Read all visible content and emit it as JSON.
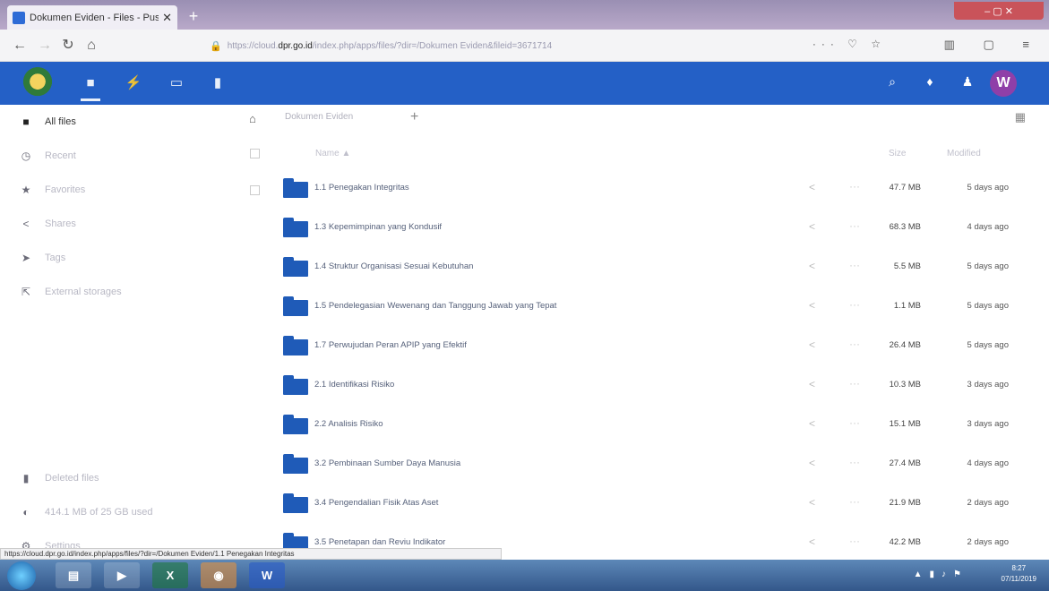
{
  "browser": {
    "tab_title": "Dokumen Eviden - Files - Pus...",
    "tab_close": "✕",
    "new_tab": "+",
    "url_prefix": "https://cloud.",
    "url_host": "dpr.go.id",
    "url_rest": "/index.php/apps/files/?dir=/Dokumen Eviden&fileid=3671714",
    "url_actions": "··· ♡ ☆",
    "right_icons": "▥ ▢ ≡",
    "window_controls": "‒ ▢ ✕"
  },
  "header": {
    "avatar_letter": "W",
    "apps": [
      {
        "name": "files-app",
        "glyph": "■"
      },
      {
        "name": "activity-app",
        "glyph": "⚡"
      },
      {
        "name": "gallery-app",
        "glyph": "▭"
      },
      {
        "name": "notes-app",
        "glyph": "▮"
      }
    ]
  },
  "sidebar": {
    "items": [
      {
        "label": "All files",
        "icon": "folder-icon"
      },
      {
        "label": "Recent",
        "icon": "clock-icon"
      },
      {
        "label": "Favorites",
        "icon": "star-icon"
      },
      {
        "label": "Shares",
        "icon": "share-icon"
      },
      {
        "label": "Tags",
        "icon": "tag-icon"
      },
      {
        "label": "External storages",
        "icon": "external-icon"
      }
    ],
    "deleted": "Deleted files",
    "quota": "414.1 MB of 25 GB used",
    "settings": "Settings"
  },
  "breadcrumb": {
    "current": "Dokumen Eviden"
  },
  "table": {
    "col_name": "Name ▲",
    "col_size": "Size",
    "col_modified": "Modified",
    "rows": [
      {
        "name": "1.1 Penegakan Integritas",
        "size": "47.7 MB",
        "modified": "5 days ago"
      },
      {
        "name": "1.3 Kepemimpinan yang Kondusif",
        "size": "68.3 MB",
        "modified": "4 days ago"
      },
      {
        "name": "1.4 Struktur Organisasi Sesuai Kebutuhan",
        "size": "5.5 MB",
        "modified": "5 days ago"
      },
      {
        "name": "1.5 Pendelegasian Wewenang dan Tanggung Jawab yang Tepat",
        "size": "1.1 MB",
        "modified": "5 days ago"
      },
      {
        "name": "1.7 Perwujudan Peran APIP yang Efektif",
        "size": "26.4 MB",
        "modified": "5 days ago"
      },
      {
        "name": "2.1 Identifikasi Risiko",
        "size": "10.3 MB",
        "modified": "3 days ago"
      },
      {
        "name": "2.2 Analisis Risiko",
        "size": "15.1 MB",
        "modified": "3 days ago"
      },
      {
        "name": "3.2 Pembinaan Sumber Daya Manusia",
        "size": "27.4 MB",
        "modified": "4 days ago"
      },
      {
        "name": "3.4 Pengendalian Fisik Atas Aset",
        "size": "21.9 MB",
        "modified": "2 days ago"
      },
      {
        "name": "3.5 Penetapan dan Reviu Indikator",
        "size": "42.2 MB",
        "modified": "2 days ago"
      }
    ]
  },
  "status_url": "https://cloud.dpr.go.id/index.php/apps/files/?dir=/Dokumen Eviden/1.1 Penegakan Integritas",
  "taskbar": {
    "time": "8:27",
    "date": "07/11/2019"
  }
}
